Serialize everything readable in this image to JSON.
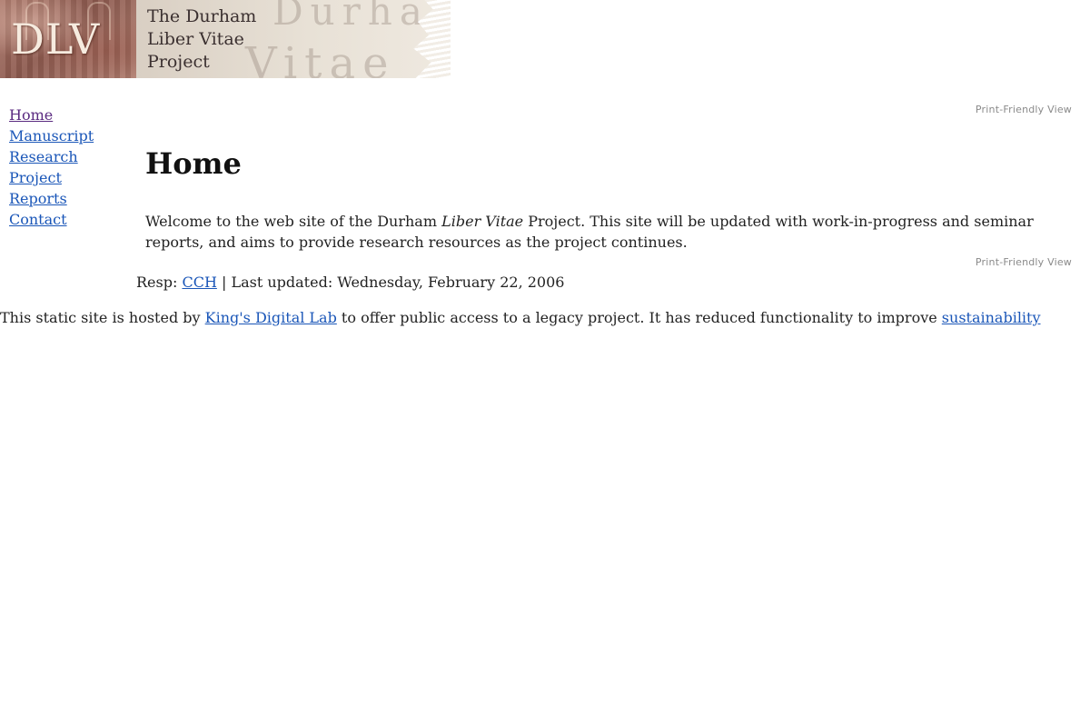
{
  "banner": {
    "logo_text": "DLV",
    "title_lines": [
      "The Durham",
      "Liber Vitae",
      "Project"
    ],
    "ghost_text_1": "Durham",
    "ghost_text_2": "Vitae"
  },
  "sidebar": {
    "items": [
      {
        "label": "Home"
      },
      {
        "label": "Manuscript"
      },
      {
        "label": "Research"
      },
      {
        "label": "Project"
      },
      {
        "label": "Reports"
      },
      {
        "label": "Contact"
      }
    ]
  },
  "print_view": {
    "label": "Print-Friendly View"
  },
  "main": {
    "title": "Home",
    "intro_before": "Welcome to the web site of the Durham ",
    "intro_italic": "Liber Vitae",
    "intro_after": " Project. This site will be updated with work-in-progress and seminar reports, and aims to provide research resources as the project continues."
  },
  "footer": {
    "resp_label": "Resp: ",
    "resp_link": "CCH",
    "separator": " | ",
    "updated_label": "Last updated: ",
    "updated_date": "Wednesday, February 22, 2006"
  },
  "hosting": {
    "text_before": "This static site is hosted by ",
    "link_1": "King's Digital Lab",
    "text_middle": " to offer public access to a legacy project. It has reduced functionality to improve ",
    "link_2": "sustainability"
  },
  "colors": {
    "link": "#1a56b8",
    "visited_link": "#5a2a80",
    "print_link": "#8a8a8a",
    "banner_red": "#8d5a4f"
  }
}
